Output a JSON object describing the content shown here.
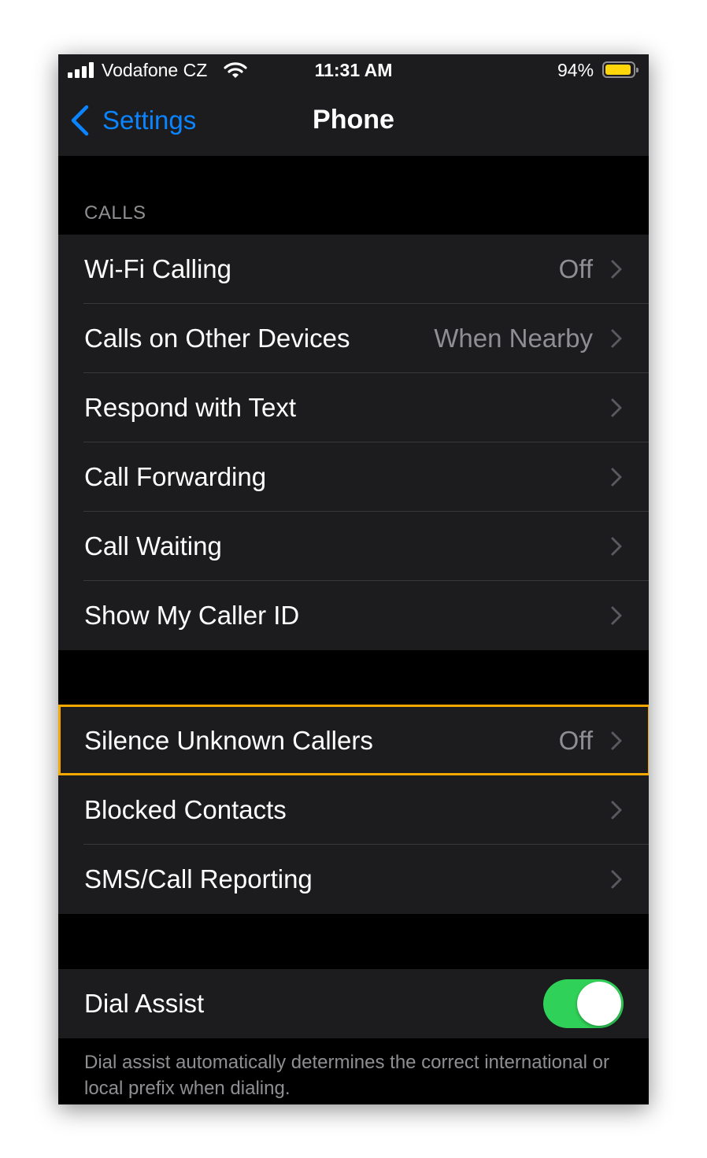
{
  "colors": {
    "accent": "#0a84ff",
    "toggle_on": "#30d158",
    "battery": "#ffd60a",
    "highlight": "#f5a800"
  },
  "status_bar": {
    "carrier": "Vodafone CZ",
    "time": "11:31 AM",
    "battery_percent": "94%",
    "battery_level": 0.94,
    "icons": [
      "cellular-signal-icon",
      "wifi-icon",
      "battery-icon"
    ]
  },
  "nav": {
    "back_label": "Settings",
    "title": "Phone",
    "back_icon": "chevron-left-icon"
  },
  "calls_section": {
    "header": "CALLS",
    "rows": [
      {
        "label": "Wi-Fi Calling",
        "value": "Off"
      },
      {
        "label": "Calls on Other Devices",
        "value": "When Nearby"
      },
      {
        "label": "Respond with Text",
        "value": ""
      },
      {
        "label": "Call Forwarding",
        "value": ""
      },
      {
        "label": "Call Waiting",
        "value": ""
      },
      {
        "label": "Show My Caller ID",
        "value": ""
      }
    ]
  },
  "block_section": {
    "rows": [
      {
        "label": "Silence Unknown Callers",
        "value": "Off",
        "highlighted": true
      },
      {
        "label": "Blocked Contacts",
        "value": ""
      },
      {
        "label": "SMS/Call Reporting",
        "value": ""
      }
    ]
  },
  "dial_section": {
    "label": "Dial Assist",
    "toggle_on": true,
    "footnote": "Dial assist automatically determines the correct international or local prefix when dialing."
  }
}
